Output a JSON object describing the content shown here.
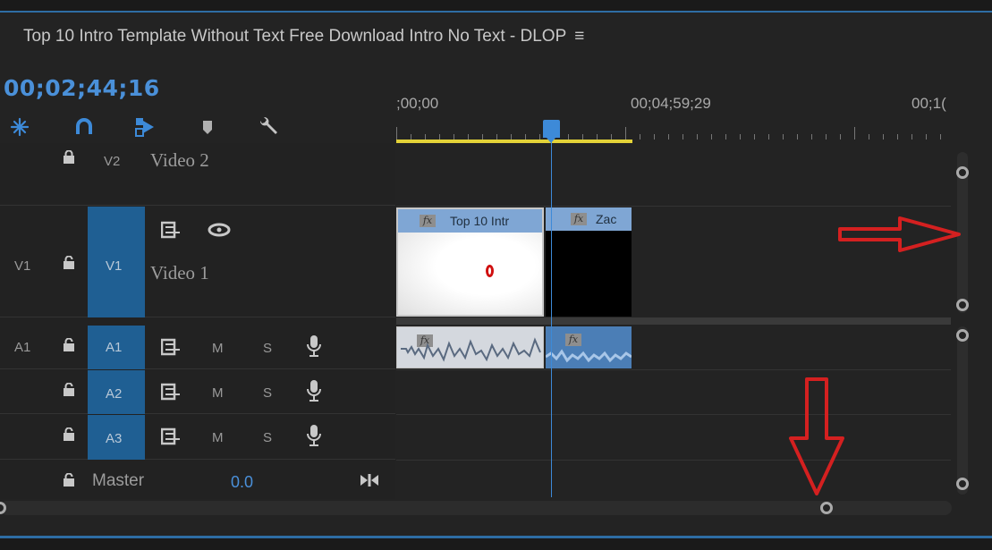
{
  "panel": {
    "title": "Top 10 Intro Template Without Text Free Download Intro No Text - DLOP",
    "menu_icon": "≡"
  },
  "timecode": "00;02;44;16",
  "toolbar": [
    {
      "name": "snap-icon"
    },
    {
      "name": "linked-selection-icon"
    },
    {
      "name": "insert-nested-icon"
    },
    {
      "name": "add-marker-icon"
    },
    {
      "name": "settings-wrench-icon"
    }
  ],
  "ruler": {
    "labels": [
      ";00;00",
      "00;04;59;29",
      "00;1("
    ]
  },
  "tracks": {
    "v2": {
      "target": "V2",
      "name": "Video 2"
    },
    "v1": {
      "source": "V1",
      "target": "V1",
      "name": "Video 1"
    },
    "a1": {
      "source": "A1",
      "target": "A1",
      "m": "M",
      "s": "S"
    },
    "a2": {
      "target": "A2",
      "m": "M",
      "s": "S"
    },
    "a3": {
      "target": "A3",
      "m": "M",
      "s": "S"
    },
    "master": {
      "name": "Master",
      "value": "0.0"
    }
  },
  "clips": {
    "video1": {
      "name": "Top 10 Intr",
      "fx": "fx"
    },
    "video2": {
      "name": "Zac",
      "fx": "fx"
    },
    "audio1": {
      "fx": "fx"
    },
    "audio2": {
      "fx": "fx"
    }
  },
  "colors": {
    "accent": "#3d8ad8",
    "work_area": "#e3d238",
    "clip_video": "#7fa6d4",
    "track_target": "#1f5f93",
    "annotation_arrow": "#d42020"
  }
}
